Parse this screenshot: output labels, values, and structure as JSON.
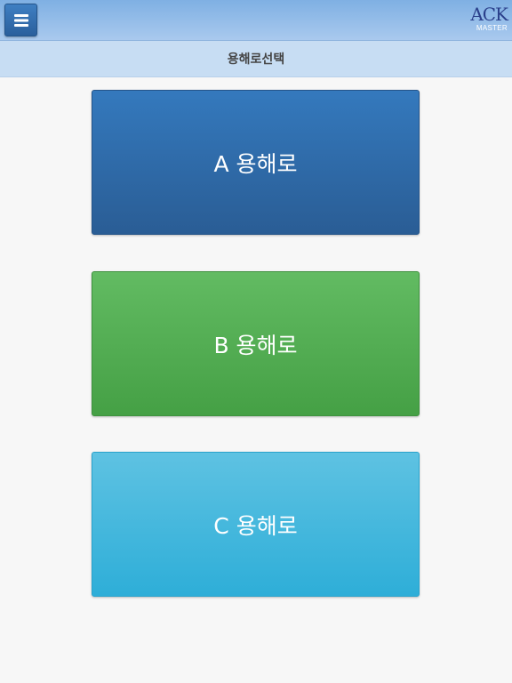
{
  "header": {
    "menu_icon": "hamburger-menu-icon",
    "logo": {
      "main": "ACK",
      "sub": "MASTER"
    }
  },
  "subheader": {
    "title": "용해로선택"
  },
  "furnaces": [
    {
      "label": "A 용해로",
      "color": "#2f6aaa"
    },
    {
      "label": "B 용해로",
      "color": "#52ad52"
    },
    {
      "label": "C 용해로",
      "color": "#43b7de"
    }
  ]
}
